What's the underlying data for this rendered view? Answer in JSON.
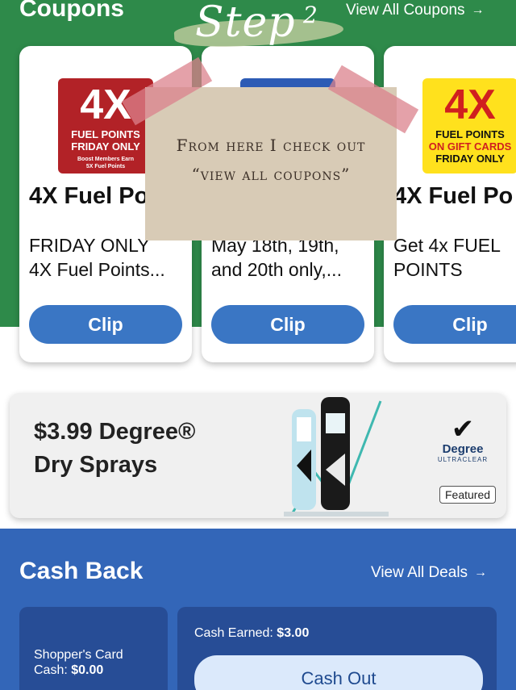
{
  "coupons": {
    "title": "Coupons",
    "view_all": "View All Coupons",
    "arrow": "→",
    "cards": [
      {
        "badge_big": "4X",
        "badge_line1": "FUEL POINTS",
        "badge_line2": "FRIDAY ONLY",
        "badge_small1": "Boost Members Earn",
        "badge_small2": "5X Fuel Points",
        "title": "4X Fuel Po",
        "desc_line1": "FRIDAY ONLY",
        "desc_line2": "4X Fuel Points...",
        "clip": "Clip"
      },
      {
        "title": "",
        "desc_line1": "May 18th, 19th,",
        "desc_line2": "and 20th only,...",
        "clip": "Clip"
      },
      {
        "badge_big": "4X",
        "badge_line1": "FUEL POINTS",
        "badge_line2": "ON GIFT CARDS",
        "badge_line3": "FRIDAY ONLY",
        "title": "4X Fuel Po",
        "desc_line1": "Get 4x FUEL",
        "desc_line2": "POINTS",
        "clip": "Clip"
      }
    ]
  },
  "annotation": {
    "step_text": "Step",
    "step_sup": "2",
    "note_line1": "From here I check out",
    "note_line2": "“view all coupons”"
  },
  "promo": {
    "title_line1": "$3.99 Degree®",
    "title_line2": "Dry Sprays",
    "brand": "Degree",
    "brand_sub": "ULTRACLEAR",
    "check": "✔",
    "featured": "Featured"
  },
  "cashback": {
    "title": "Cash Back",
    "view_all": "View All Deals",
    "arrow": "→",
    "shoppers_card_label": "Shopper's Card",
    "cash_label": "Cash:",
    "cash_value": "$0.00",
    "cash_earned_label": "Cash Earned:",
    "cash_earned_value": "$3.00",
    "cash_out": "Cash Out"
  },
  "colors": {
    "green": "#2e8a4a",
    "blue": "#3366b8",
    "clip_blue": "#3a76c4",
    "badge_red": "#b22227",
    "badge_yellow": "#ffe11d"
  }
}
